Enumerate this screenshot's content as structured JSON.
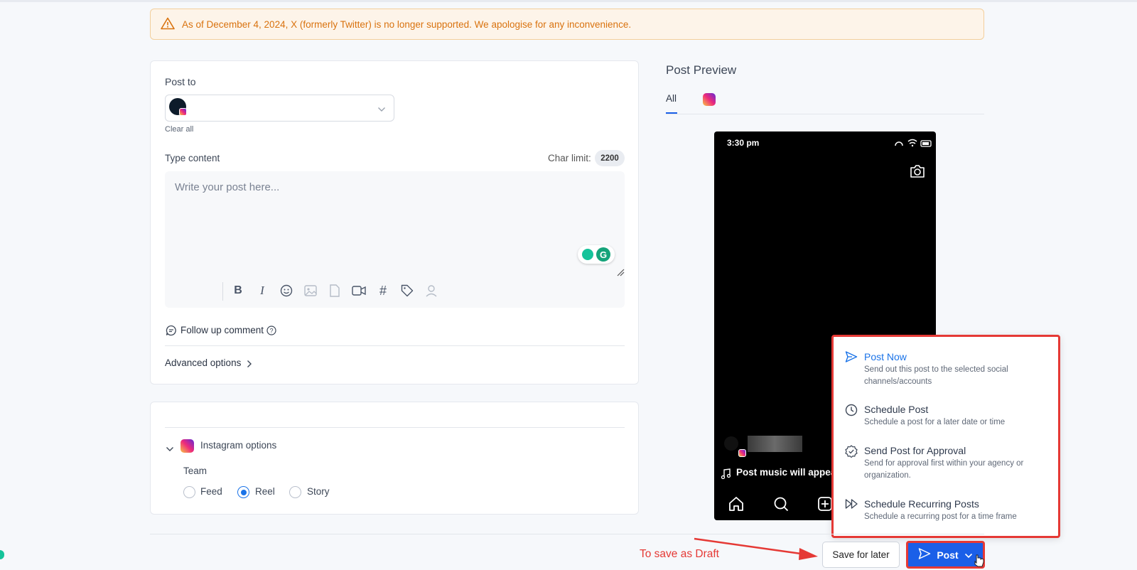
{
  "banner": {
    "text": "As of December 4, 2024, X (formerly Twitter) is no longer supported. We apologise for any inconvenience.",
    "icon": "warning-icon"
  },
  "composer": {
    "post_to_label": "Post to",
    "clear_all": "Clear all",
    "type_content_label": "Type content",
    "char_limit_label": "Char limit:",
    "char_limit_value": "2200",
    "placeholder": "Write your post here...",
    "follow_up_label": "Follow up comment",
    "advanced_label": "Advanced options"
  },
  "instagram_options": {
    "title": "Instagram options",
    "team_label": "Team",
    "radios": [
      {
        "label": "Feed",
        "checked": false
      },
      {
        "label": "Reel",
        "checked": true
      },
      {
        "label": "Story",
        "checked": false
      }
    ]
  },
  "preview": {
    "title": "Post Preview",
    "tab_all": "All",
    "phone_time": "3:30 pm",
    "music_text": "Post music will appear"
  },
  "dropdown": {
    "items": [
      {
        "title": "Post Now",
        "desc": "Send out this post to the selected social channels/accounts",
        "icon": "send-icon"
      },
      {
        "title": "Schedule Post",
        "desc": "Schedule a post for a later date or time",
        "icon": "clock-icon"
      },
      {
        "title": "Send Post for Approval",
        "desc": "Send for approval first within your agency or organization.",
        "icon": "badge-check-icon"
      },
      {
        "title": "Schedule Recurring Posts",
        "desc": "Schedule a recurring post for a time frame",
        "icon": "recurring-icon"
      }
    ]
  },
  "footer": {
    "save_label": "Save for later",
    "post_label": "Post",
    "annotation": "To save as Draft"
  },
  "colors": {
    "accent": "#1a5fe8",
    "highlight_red": "#e53935",
    "banner_text": "#d9720e"
  }
}
